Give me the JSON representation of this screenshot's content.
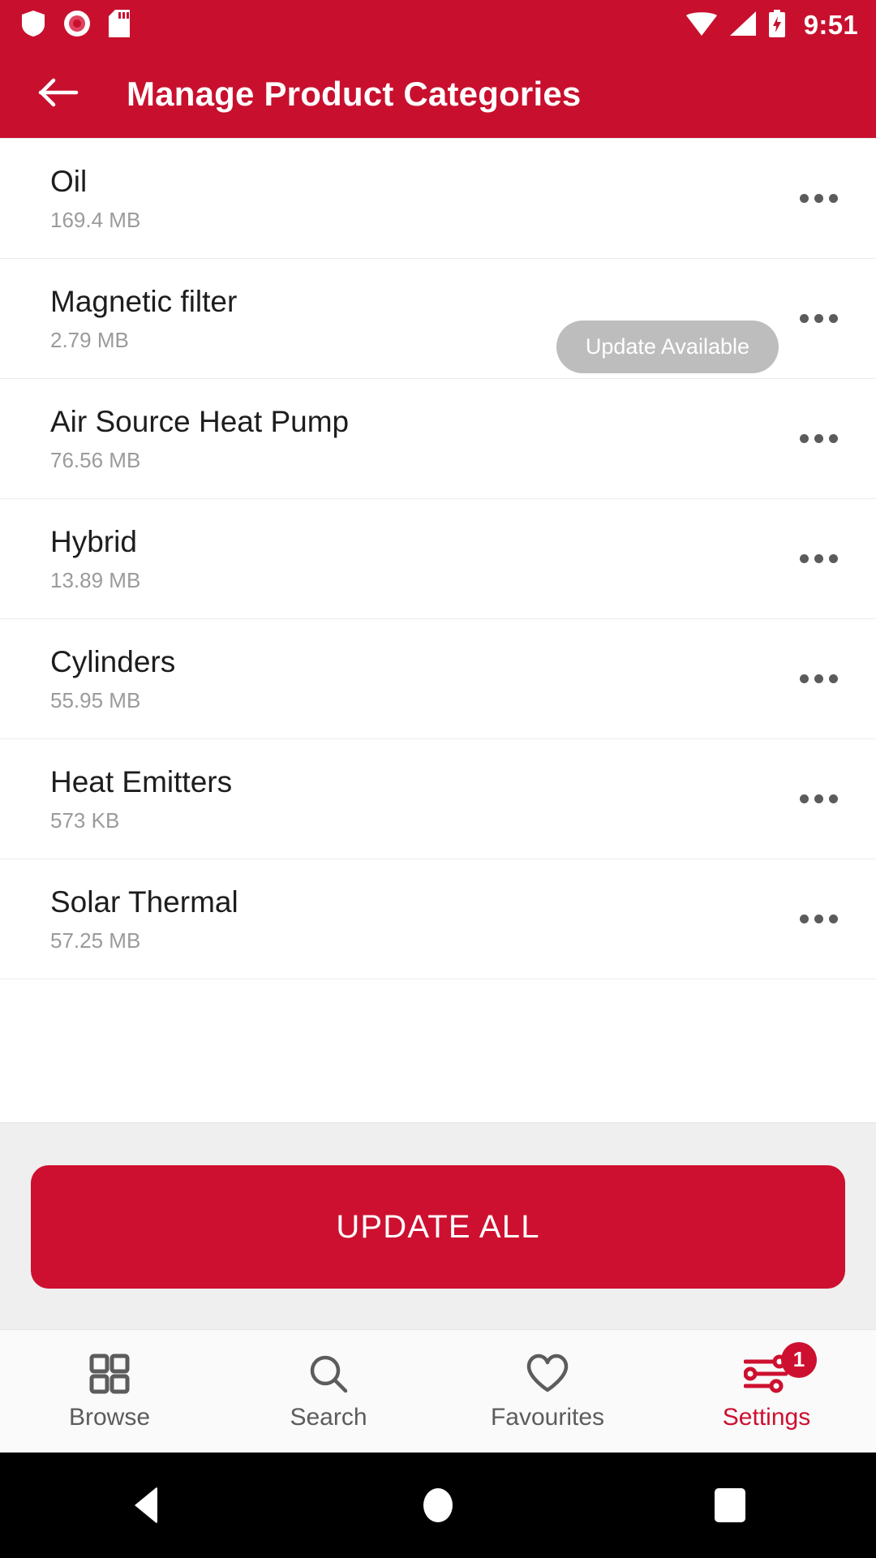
{
  "status_bar": {
    "icons_left": [
      "shield-icon",
      "record-icon",
      "sd-card-icon"
    ],
    "icons_right": [
      "wifi-icon",
      "signal-icon",
      "battery-charging-icon"
    ],
    "time": "9:51"
  },
  "app_bar": {
    "back_icon": "arrow-back-icon",
    "title": "Manage Product Categories"
  },
  "colors": {
    "brand_red": "#C8102E",
    "button_red": "#CE1030",
    "badge_gray": "#bdbdbd",
    "action_bg": "#efefef"
  },
  "list": {
    "overflow_icon": "more-options-icon",
    "items": [
      {
        "name": "Oil",
        "size": "169.4 MB",
        "status": null
      },
      {
        "name": "Magnetic filter",
        "size": "2.79 MB",
        "status": "Update Available"
      },
      {
        "name": "Air Source Heat Pump",
        "size": "76.56 MB",
        "status": null
      },
      {
        "name": "Hybrid",
        "size": "13.89 MB",
        "status": null
      },
      {
        "name": "Cylinders",
        "size": "55.95 MB",
        "status": null
      },
      {
        "name": "Heat Emitters",
        "size": "573 KB",
        "status": null
      },
      {
        "name": "Solar Thermal",
        "size": "57.25 MB",
        "status": null
      }
    ]
  },
  "action": {
    "update_all_label": "UPDATE ALL"
  },
  "bottom_nav": {
    "items": [
      {
        "label": "Browse",
        "icon": "grid-icon",
        "active": false,
        "badge": null
      },
      {
        "label": "Search",
        "icon": "search-icon",
        "active": false,
        "badge": null
      },
      {
        "label": "Favourites",
        "icon": "heart-icon",
        "active": false,
        "badge": null
      },
      {
        "label": "Settings",
        "icon": "sliders-icon",
        "active": true,
        "badge": "1"
      }
    ]
  },
  "system_nav": {
    "back": "back-triangle-icon",
    "home": "home-circle-icon",
    "recents": "recents-square-icon"
  }
}
